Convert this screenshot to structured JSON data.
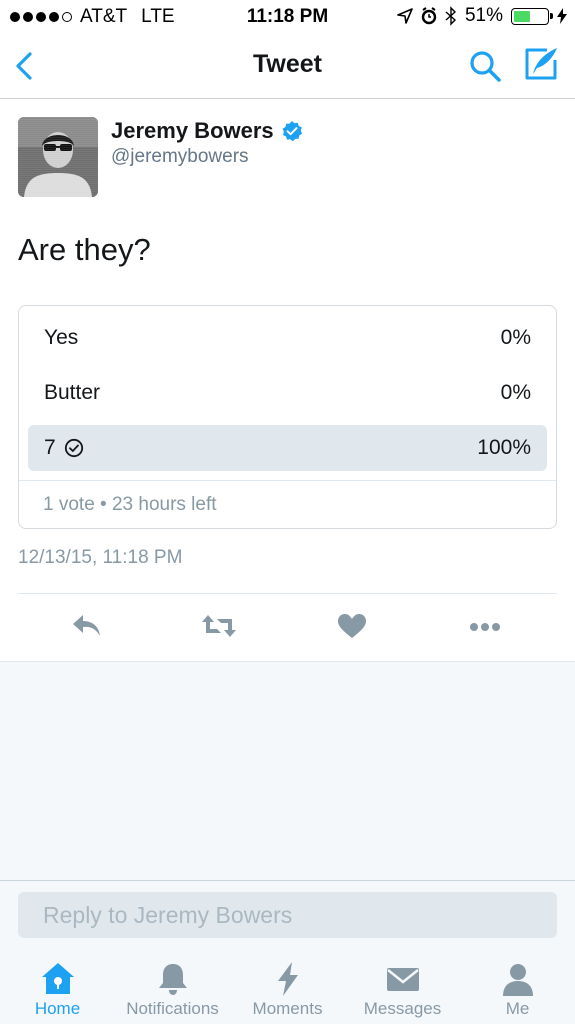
{
  "status_bar": {
    "carrier": "AT&T",
    "network": "LTE",
    "time": "11:18 PM",
    "battery_percent": "51%",
    "battery_level": 0.51,
    "signal_bars": 4
  },
  "nav": {
    "title": "Tweet",
    "icons": [
      "back-icon",
      "search-icon",
      "compose-icon"
    ]
  },
  "tweet": {
    "author_name": "Jeremy Bowers",
    "author_handle": "@jeremybowers",
    "verified": true,
    "text": "Are they?",
    "timestamp": "12/13/15, 11:18 PM"
  },
  "poll": {
    "options": [
      {
        "label": "Yes",
        "percent": "0%"
      },
      {
        "label": "Butter",
        "percent": "0%"
      },
      {
        "label": "7",
        "percent": "100%",
        "selected": true
      }
    ],
    "meta": "1 vote • 23 hours left"
  },
  "actions": [
    "reply-icon",
    "retweet-icon",
    "like-icon",
    "more-icon"
  ],
  "reply": {
    "placeholder": "Reply to Jeremy Bowers"
  },
  "tabs": [
    {
      "label": "Home",
      "icon": "home-icon",
      "active": true
    },
    {
      "label": "Notifications",
      "icon": "bell-icon"
    },
    {
      "label": "Moments",
      "icon": "lightning-icon"
    },
    {
      "label": "Messages",
      "icon": "envelope-icon"
    },
    {
      "label": "Me",
      "icon": "person-icon"
    }
  ],
  "colors": {
    "accent": "#1da1f2",
    "secondary_text": "#8899a6",
    "poll_highlight": "#e1e8ed",
    "icon_gray": "#8899a6",
    "battery_green": "#4cd964"
  }
}
